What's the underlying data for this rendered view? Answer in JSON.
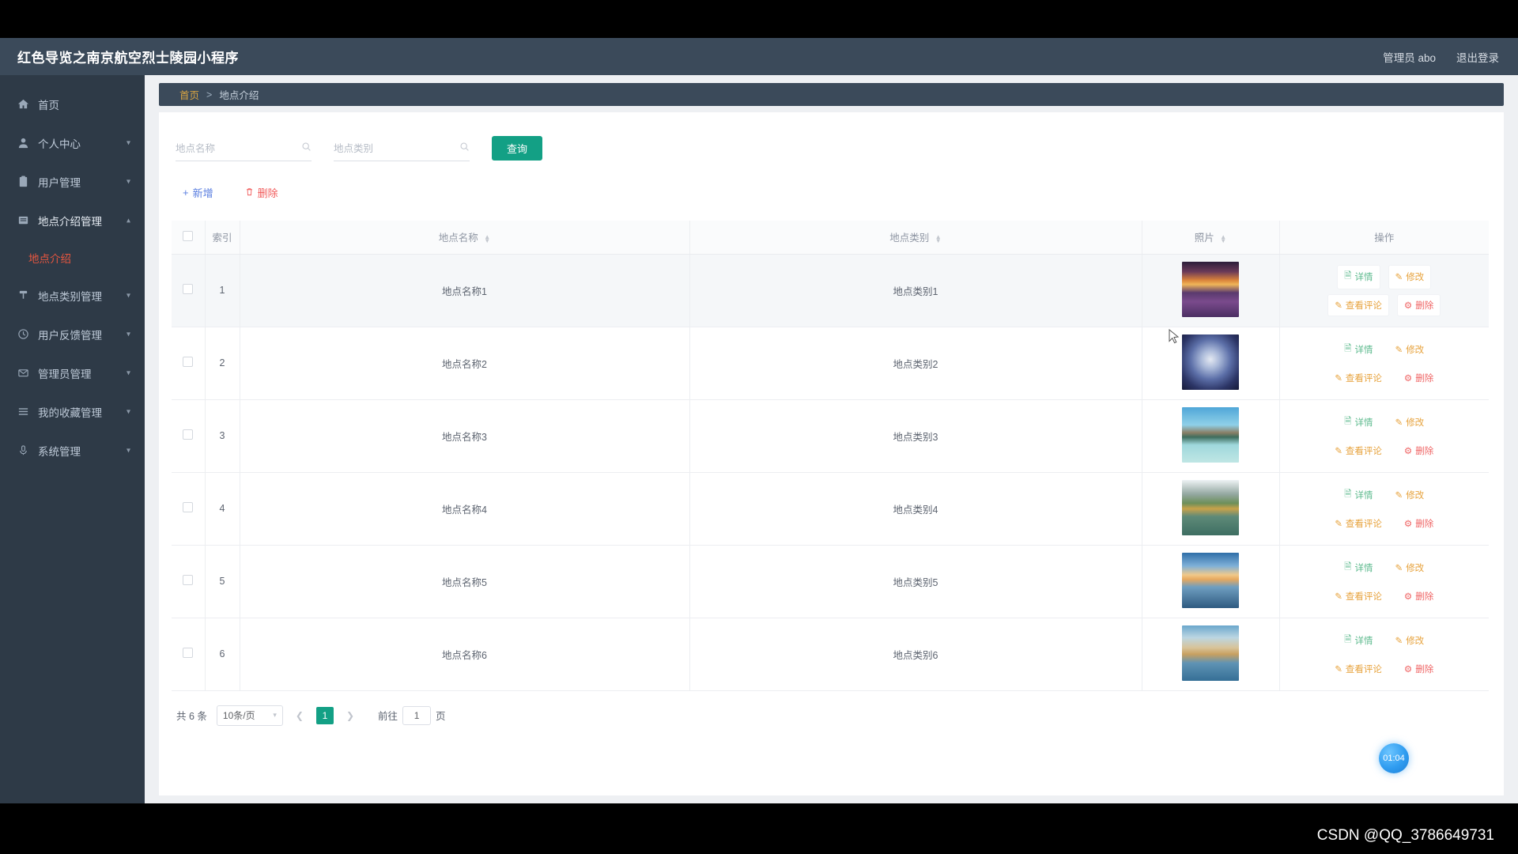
{
  "header": {
    "brand": "红色导览之南京航空烈士陵园小程序",
    "user": "管理员 abo",
    "logout": "退出登录"
  },
  "sidebar": {
    "items": [
      {
        "label": "首页",
        "icon": "home-icon",
        "expandable": false
      },
      {
        "label": "个人中心",
        "icon": "user-icon",
        "expandable": true
      },
      {
        "label": "用户管理",
        "icon": "clipboard-icon",
        "expandable": true
      },
      {
        "label": "地点介绍管理",
        "icon": "book-icon",
        "expandable": true
      },
      {
        "label": "地点类别管理",
        "icon": "pin-icon",
        "expandable": true
      },
      {
        "label": "用户反馈管理",
        "icon": "clock-icon",
        "expandable": true
      },
      {
        "label": "管理员管理",
        "icon": "mail-icon",
        "expandable": true
      },
      {
        "label": "我的收藏管理",
        "icon": "list-icon",
        "expandable": true
      },
      {
        "label": "系统管理",
        "icon": "mic-icon",
        "expandable": true
      }
    ],
    "submenu_label": "地点介绍",
    "submenu_parent_index": 3,
    "active_color": "#e8563f"
  },
  "breadcrumb": {
    "home": "首页",
    "separator": ">",
    "current": "地点介绍"
  },
  "search": {
    "name_placeholder": "地点名称",
    "name_value": "",
    "category_placeholder": "地点类别",
    "category_value": "",
    "query_label": "查询",
    "search_icon": "search-icon"
  },
  "toolbar": {
    "add_label": "新增",
    "add_icon": "plus-icon",
    "delete_label": "删除",
    "delete_icon": "trash-icon"
  },
  "table": {
    "columns": [
      {
        "key": "check",
        "label": "",
        "sortable": false
      },
      {
        "key": "index",
        "label": "索引",
        "sortable": false
      },
      {
        "key": "name",
        "label": "地点名称",
        "sortable": true
      },
      {
        "key": "category",
        "label": "地点类别",
        "sortable": true
      },
      {
        "key": "photo",
        "label": "照片",
        "sortable": true
      },
      {
        "key": "ops",
        "label": "操作",
        "sortable": false
      }
    ],
    "row_actions": [
      {
        "key": "detail",
        "label": "详情",
        "icon": "doc-icon"
      },
      {
        "key": "edit",
        "label": "修改",
        "icon": "pencil-icon"
      },
      {
        "key": "comments",
        "label": "查看评论",
        "icon": "pencil-icon"
      },
      {
        "key": "delete",
        "label": "删除",
        "icon": "trash-icon"
      }
    ],
    "rows": [
      {
        "index": "1",
        "name": "地点名称1",
        "category": "地点类别1",
        "photo": "sunset-lavender-field",
        "highlighted": true
      },
      {
        "index": "2",
        "name": "地点名称2",
        "category": "地点类别2",
        "photo": "blue-starry-night",
        "highlighted": false
      },
      {
        "index": "3",
        "name": "地点名称3",
        "category": "地点类别3",
        "photo": "lake-mountains",
        "highlighted": false
      },
      {
        "index": "4",
        "name": "地点名称4",
        "category": "地点类别4",
        "photo": "bridge-karst-river",
        "highlighted": false
      },
      {
        "index": "5",
        "name": "地点名称5",
        "category": "地点类别5",
        "photo": "harbor-sunset",
        "highlighted": false
      },
      {
        "index": "6",
        "name": "地点名称6",
        "category": "地点类别6",
        "photo": "island-village-water",
        "highlighted": false
      }
    ]
  },
  "pagination": {
    "total_text": "共 6 条",
    "page_size": "10条/页",
    "prev_icon": "chevron-left-icon",
    "next_icon": "chevron-right-icon",
    "current_page": "1",
    "goto_label": "前往",
    "goto_value": "1",
    "page_unit": "页"
  },
  "timer": {
    "value": "01:04"
  },
  "watermark": {
    "text": "CSDN @QQ_3786649731"
  },
  "colors": {
    "primary": "#13a085",
    "topbar": "#3b4a5a",
    "sidebar": "#2e3a47",
    "accent_red": "#e8563f",
    "breadcrumb_home": "#d9a441"
  }
}
